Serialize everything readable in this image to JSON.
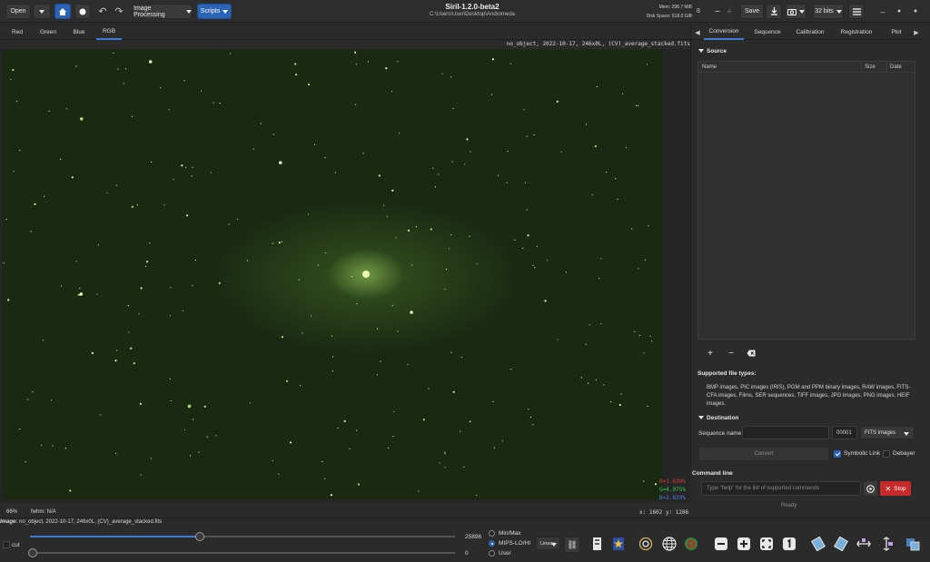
{
  "header": {
    "open_label": "Open",
    "image_processing_label": "Image Processing",
    "scripts_label": "Scripts",
    "app_title": "Siril-1.2.0-beta2",
    "app_path": "C:\\Users\\User\\Desktop\\Andromeda",
    "mem_label": "Mem: 298.7 MiB",
    "disk_label": "Disk Space: 518.0 GiB",
    "save_label": "Save",
    "bits_label": "32 bits",
    "accent_color": "#2b63b5"
  },
  "channel_tabs": [
    "Red",
    "Green",
    "Blue",
    "RGB"
  ],
  "image_caption": "no_object, 2022-10-17, 246x0L, (CV)_average_stacked.fits",
  "rgb_readout": {
    "r": "R=1.639%",
    "g": "G=4.975%",
    "b": "B=2.839%"
  },
  "status": {
    "zoom": "66%",
    "fwhm": "fwhm: N/A",
    "coords": "x: 1602  y: 1286"
  },
  "panel": {
    "tabs": [
      "Conversion",
      "Sequence",
      "Calibration",
      "Registration",
      "Plot"
    ],
    "source_title": "Source",
    "list_columns": {
      "name": "Name",
      "size": "Size",
      "date": "Date"
    },
    "supported_title": "Supported file types:",
    "supported_text": "BMP images, PIC images (IRIS), PGM and PPM binary images, RAW images, FITS-CFA images, Films, SER sequences, TIFF images, JPG images, PNG images, HEIF images.",
    "destination_title": "Destination",
    "sequence_name_label": "Sequence name:",
    "sequence_name_value": "",
    "start_index": "00001",
    "output_format": "FITS images",
    "convert_label": "Convert",
    "symbolic_link_label": "Symbolic Link",
    "symbolic_link_checked": true,
    "debayer_label": "Debayer",
    "debayer_checked": false
  },
  "command_line": {
    "title": "Command line",
    "placeholder": "Type \"help\" for the list of supported commands",
    "stop_label": "Stop",
    "status": "Ready"
  },
  "bottom": {
    "image_label_prefix": "Image:",
    "image_label_value": "no_object, 2022-10-17, 246x0L, (CV)_average_stacked.fits",
    "cut_label": "cut",
    "high_value": "25896",
    "low_value": "0",
    "high_slider_fraction": 0.4,
    "low_slider_fraction": 0.0,
    "radio_options": [
      "Min/Max",
      "MIPS-LO/HI",
      "User"
    ],
    "radio_selected": "MIPS-LO/HI",
    "stretch_mode": "Linear"
  }
}
